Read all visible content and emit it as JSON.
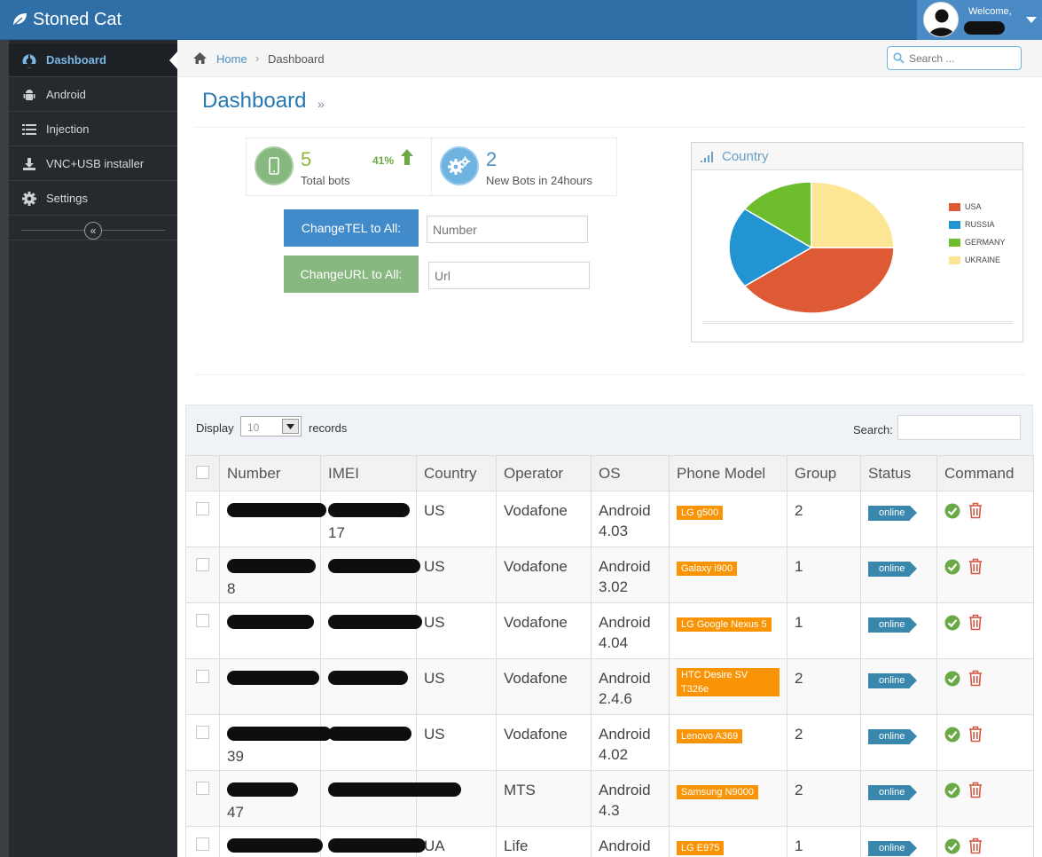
{
  "app": {
    "title": "Stoned Cat"
  },
  "user": {
    "welcome": "Welcome,"
  },
  "sidebar": {
    "items": [
      {
        "label": "Dashboard",
        "icon": "dashboard-icon",
        "active": true
      },
      {
        "label": "Android",
        "icon": "android-icon"
      },
      {
        "label": "Injection",
        "icon": "list-icon"
      },
      {
        "label": "VNC+USB installer",
        "icon": "download-icon"
      },
      {
        "label": "Settings",
        "icon": "gear-icon"
      }
    ],
    "collapse_label": "«"
  },
  "breadcrumb": {
    "home": "Home",
    "current": "Dashboard"
  },
  "search": {
    "placeholder": "Search ..."
  },
  "page": {
    "title": "Dashboard",
    "arrows": "»"
  },
  "infobox": {
    "total": {
      "number": "5",
      "label": "Total bots",
      "percent": "41%"
    },
    "new": {
      "number": "2",
      "label": "New Bots in 24hours"
    }
  },
  "actions": {
    "tel_button": "ChangeTEL to All:",
    "tel_placeholder": "Number",
    "url_button": "ChangeURL to All:",
    "url_placeholder": "Url"
  },
  "widget": {
    "title": "Country",
    "chart_data": {
      "type": "pie",
      "categories": [
        "USA",
        "RUSSIA",
        "GERMANY",
        "UKRAINE"
      ],
      "values": [
        40,
        20,
        15,
        25
      ],
      "colors": [
        "#dd5a34",
        "#2294d2",
        "#6ebd2c",
        "#fce696"
      ]
    }
  },
  "table": {
    "display_label": "Display",
    "display_value": "10",
    "records_label": "records",
    "search_label": "Search:",
    "columns": [
      "Number",
      "IMEI",
      "Country",
      "Operator",
      "OS",
      "Phone Model",
      "Group",
      "Status",
      "Command"
    ],
    "rows": [
      {
        "number_tail": "",
        "imei_tail": "17",
        "country": "US",
        "operator": "Vodafone",
        "os": "Android 4.03",
        "model": "LG g500",
        "group": "2",
        "status": "online"
      },
      {
        "number_tail": "8",
        "imei_tail": "",
        "country": "US",
        "operator": "Vodafone",
        "os": "Android 3.02",
        "model": "Galaxy i900",
        "group": "1",
        "status": "online"
      },
      {
        "number_tail": "",
        "imei_tail": "",
        "country": "US",
        "operator": "Vodafone",
        "os": "Android 4.04",
        "model": "LG Google Nexus 5",
        "group": "1",
        "status": "online"
      },
      {
        "number_tail": "",
        "imei_tail": "",
        "country": "US",
        "operator": "Vodafone",
        "os": "Android 2.4.6",
        "model": "HTC Desire SV T326e",
        "group": "2",
        "status": "online"
      },
      {
        "number_tail": "39",
        "imei_tail": "",
        "country": "US",
        "operator": "Vodafone",
        "os": "Android 4.02",
        "model": "Lenovo A369",
        "group": "2",
        "status": "online"
      },
      {
        "number_tail": "47",
        "imei_tail": "",
        "country": "",
        "operator": "MTS",
        "os": "Android 4.3",
        "model": "Samsung N9000",
        "group": "2",
        "status": "online"
      },
      {
        "number_tail": "",
        "imei_tail": "",
        "country": "UA",
        "operator": "Life",
        "os": "Android",
        "model": "LG E975",
        "group": "1",
        "status": "online"
      }
    ]
  },
  "colors": {
    "topbar": "#2f6fa8",
    "sidebar": "#262a2f",
    "accent": "#2679b5",
    "badge": "#f89406",
    "status": "#3a87ad",
    "ok": "#69aa46",
    "delete": "#d15b47"
  }
}
